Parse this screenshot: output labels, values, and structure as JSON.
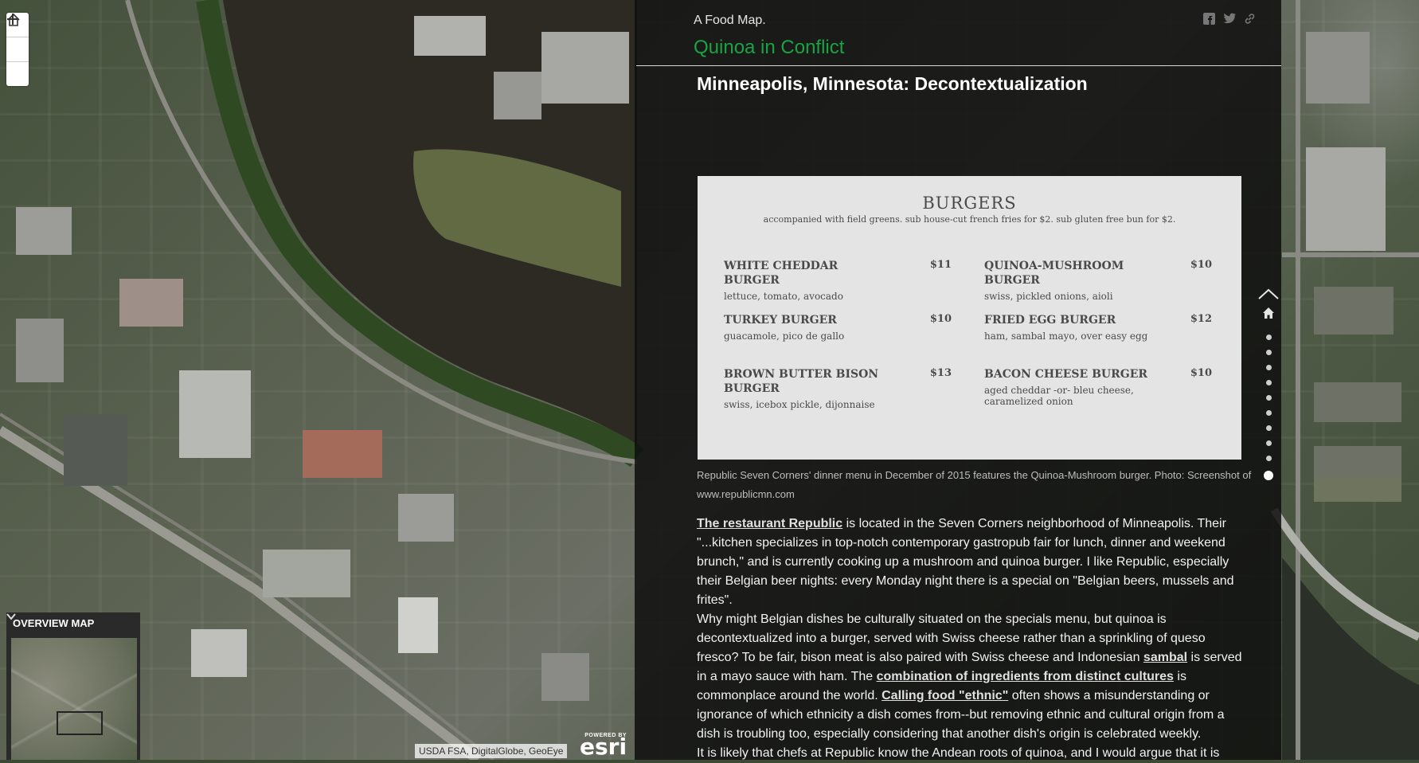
{
  "map": {
    "zoom_controls": {
      "zoom_in": "+",
      "home_icon": "home-icon",
      "zoom_out": "−"
    },
    "overview": {
      "label": "OVERVIEW MAP",
      "toggle_icon": "chevron-down-icon"
    },
    "attribution": "USDA FSA, DigitalGlobe, GeoEye",
    "logo": {
      "powered": "POWERED BY",
      "word": "esri"
    }
  },
  "panel": {
    "kicker": "A Food Map.",
    "series_title": "Quinoa in Conflict",
    "share_icons": [
      "facebook-icon",
      "twitter-icon",
      "link-icon"
    ],
    "section_title": "Minneapolis, Minnesota: Decontextualization",
    "menu": {
      "heading": "BURGERS",
      "subheading": "accompanied with field greens. sub house-cut french fries for $2. sub gluten free bun for $2.",
      "items": [
        {
          "name": "WHITE CHEDDAR BURGER",
          "price": "$11",
          "desc": "lettuce, tomato, avocado"
        },
        {
          "name": "QUINOA-MUSHROOM BURGER",
          "price": "$10",
          "desc": "swiss, pickled onions, aioli"
        },
        {
          "name": "TURKEY BURGER",
          "price": "$10",
          "desc": "guacamole, pico de gallo"
        },
        {
          "name": "FRIED EGG BURGER",
          "price": "$12",
          "desc": "ham, sambal mayo, over easy egg"
        },
        {
          "name": "BROWN BUTTER BISON BURGER",
          "price": "$13",
          "desc": "swiss, icebox pickle, dijonnaise"
        },
        {
          "name": "BACON CHEESE BURGER",
          "price": "$10",
          "desc": "aged cheddar -or- bleu cheese, caramelized onion"
        }
      ]
    },
    "caption": "Republic Seven Corners' dinner menu in December of 2015 features the Quinoa-Mushroom burger. Photo: Screenshot of www.republicmn.com",
    "p1": {
      "link": "The restaurant Republic",
      "text": " is located in the Seven Corners neighborhood of Minneapolis. Their \"...kitchen specializes in top-notch contemporary gastropub fair for lunch, dinner and weekend brunch,\" and is currently cooking up a mushroom and quinoa burger. I like Republic, especially their Belgian beer nights: every Monday night there is a special on \"Belgian beers, mussels and frites\"."
    },
    "p2": {
      "t1": "Why might Belgian dishes be culturally situated on the specials menu, but quinoa is decontextualized into a burger, served with Swiss cheese rather than a sprinkling of queso fresco? To be fair, bison meat is also paired with Swiss cheese and Indonesian ",
      "link1": "sambal",
      "t2": " is served in a mayo sauce with ham. The ",
      "link2": "combination of ingredients from distinct cultures",
      "t3": " is commonplace around the world. ",
      "link3": "Calling food \"ethnic\"",
      "t4": " often shows a misunderstanding or ignorance of which ethnicity a dish comes from--but removing ethnic and cultural origin from a dish is troubling too, especially considering that another dish's origin is celebrated weekly."
    },
    "p3": "It is likely that chefs at Republic know the Andean roots of quinoa, and I would argue that it is",
    "nav": {
      "up_icon": "chevron-up-icon",
      "home_icon": "home-icon",
      "dot_count": 10,
      "active_index": 9
    }
  }
}
